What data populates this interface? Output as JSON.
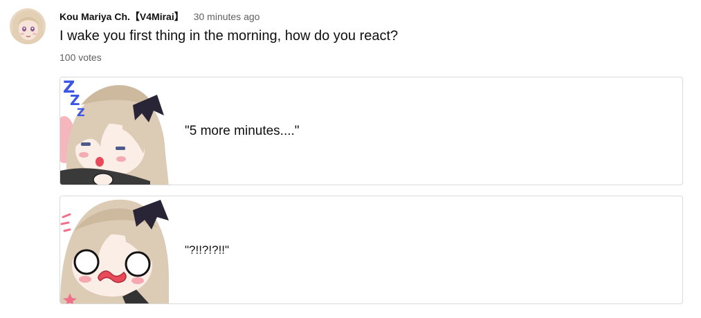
{
  "post": {
    "author": "Kou Mariya Ch.【V4Mirai】",
    "time": "30 minutes ago",
    "question": "I wake you first thing in the morning, how do you react?",
    "votes": "100 votes",
    "avatar_icon": "avatar-icon"
  },
  "options": [
    {
      "label": "\"5 more minutes....\"",
      "image": "sleepy-chibi-image"
    },
    {
      "label": "\"?!!?!?!!\"",
      "image": "shocked-chibi-image"
    }
  ],
  "colors": {
    "text_primary": "#0f0f0f",
    "text_secondary": "#606060",
    "border": "#d9d9d9",
    "hair": "#dccbb5",
    "bat_wing": "#2a2536",
    "zzz": "#3b55e6",
    "blush": "#f49aa6"
  }
}
